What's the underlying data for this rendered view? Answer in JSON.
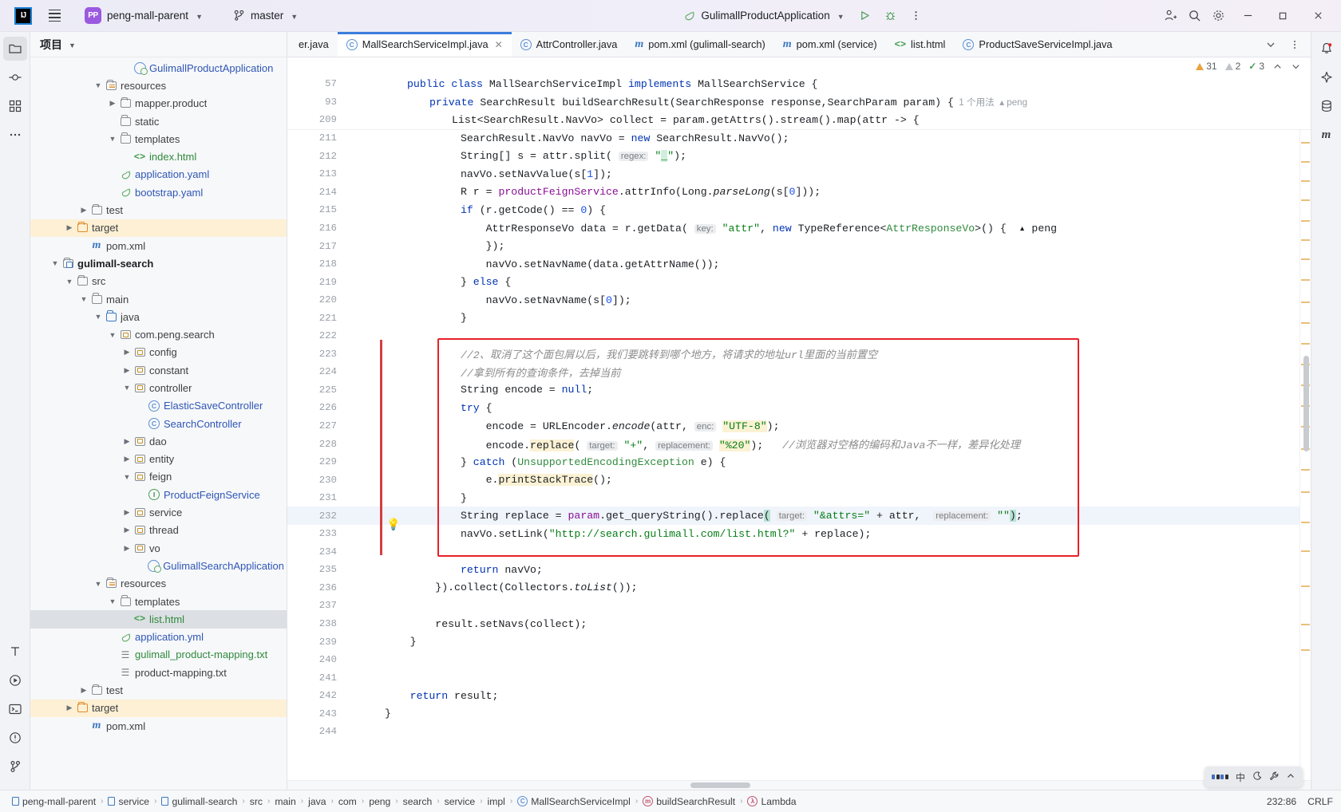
{
  "titlebar": {
    "logo": "IJ",
    "menu_icon": "hamburger-icon",
    "project_badge": "PP",
    "project_name": "peng-mall-parent",
    "branch_icon": "git-branch-icon",
    "branch_name": "master",
    "run_config_icon": "spring-boot-icon",
    "run_config": "GulimallProductApplication",
    "run_icon": "run-icon",
    "debug_icon": "debug-icon",
    "more_icon": "more-vertical-icon",
    "account_icon": "add-user-icon",
    "search_icon": "search-icon",
    "settings_icon": "gear-icon",
    "minimize": "–",
    "maximize": "❐",
    "close": "✕"
  },
  "left_rail": [
    {
      "name": "project-tool-icon",
      "glyph": "folder"
    },
    {
      "name": "commit-tool-icon",
      "glyph": "commit"
    },
    {
      "name": "structure-tool-icon",
      "glyph": "structure"
    },
    {
      "name": "more-tool-icon",
      "glyph": "dots"
    }
  ],
  "left_rail_bottom": [
    {
      "name": "todo-tool-icon",
      "glyph": "T"
    },
    {
      "name": "services-tool-icon",
      "glyph": "play"
    },
    {
      "name": "terminal-tool-icon",
      "glyph": "terminal"
    },
    {
      "name": "problems-tool-icon",
      "glyph": "warning"
    },
    {
      "name": "git-tool-icon",
      "glyph": "git"
    }
  ],
  "right_rail": [
    {
      "name": "notifications-icon",
      "glyph": "bell"
    },
    {
      "name": "ai-assistant-icon",
      "glyph": "ai"
    },
    {
      "name": "database-icon",
      "glyph": "db"
    },
    {
      "name": "maven-icon",
      "glyph": "m"
    }
  ],
  "project_panel": {
    "title": "项目",
    "title_chevron": "chevron-down-icon",
    "tree": [
      {
        "depth": 6,
        "arrow": "none",
        "icon": "spring-app",
        "label": "GulimallProductApplication",
        "color": "blue"
      },
      {
        "depth": 4,
        "arrow": "down",
        "icon": "resources",
        "label": "resources",
        "color": "grey"
      },
      {
        "depth": 5,
        "arrow": "right",
        "icon": "folder",
        "label": "mapper.product",
        "color": "grey"
      },
      {
        "depth": 5,
        "arrow": "none",
        "icon": "folder",
        "label": "static",
        "color": "grey"
      },
      {
        "depth": 5,
        "arrow": "down",
        "icon": "folder",
        "label": "templates",
        "color": "grey"
      },
      {
        "depth": 6,
        "arrow": "none",
        "icon": "html",
        "label": "index.html",
        "color": "green"
      },
      {
        "depth": 5,
        "arrow": "none",
        "icon": "spring",
        "label": "application.yaml",
        "color": "blue"
      },
      {
        "depth": 5,
        "arrow": "none",
        "icon": "spring",
        "label": "bootstrap.yaml",
        "color": "blue"
      },
      {
        "depth": 3,
        "arrow": "right",
        "icon": "folder",
        "label": "test",
        "color": "grey"
      },
      {
        "depth": 2,
        "arrow": "right",
        "icon": "folder-orange",
        "label": "target",
        "color": "grey",
        "highlight": "target"
      },
      {
        "depth": 3,
        "arrow": "none",
        "icon": "maven",
        "label": "pom.xml",
        "color": "grey"
      },
      {
        "depth": 1,
        "arrow": "down",
        "icon": "module",
        "label": "gulimall-search",
        "color": "bold"
      },
      {
        "depth": 2,
        "arrow": "down",
        "icon": "folder",
        "label": "src",
        "color": "grey"
      },
      {
        "depth": 3,
        "arrow": "down",
        "icon": "folder",
        "label": "main",
        "color": "grey"
      },
      {
        "depth": 4,
        "arrow": "down",
        "icon": "folder-blue",
        "label": "java",
        "color": "grey"
      },
      {
        "depth": 5,
        "arrow": "down",
        "icon": "package",
        "label": "com.peng.search",
        "color": "grey"
      },
      {
        "depth": 6,
        "arrow": "right",
        "icon": "package",
        "label": "config",
        "color": "grey"
      },
      {
        "depth": 6,
        "arrow": "right",
        "icon": "package",
        "label": "constant",
        "color": "grey"
      },
      {
        "depth": 6,
        "arrow": "down",
        "icon": "package",
        "label": "controller",
        "color": "grey"
      },
      {
        "depth": 7,
        "arrow": "none",
        "icon": "class",
        "label": "ElasticSaveController",
        "color": "blue"
      },
      {
        "depth": 7,
        "arrow": "none",
        "icon": "class",
        "label": "SearchController",
        "color": "blue"
      },
      {
        "depth": 6,
        "arrow": "right",
        "icon": "package",
        "label": "dao",
        "color": "grey"
      },
      {
        "depth": 6,
        "arrow": "right",
        "icon": "package",
        "label": "entity",
        "color": "grey"
      },
      {
        "depth": 6,
        "arrow": "down",
        "icon": "package",
        "label": "feign",
        "color": "grey"
      },
      {
        "depth": 7,
        "arrow": "none",
        "icon": "interface",
        "label": "ProductFeignService",
        "color": "blue"
      },
      {
        "depth": 6,
        "arrow": "right",
        "icon": "package",
        "label": "service",
        "color": "grey"
      },
      {
        "depth": 6,
        "arrow": "right",
        "icon": "package",
        "label": "thread",
        "color": "grey"
      },
      {
        "depth": 6,
        "arrow": "right",
        "icon": "package",
        "label": "vo",
        "color": "grey"
      },
      {
        "depth": 7,
        "arrow": "none",
        "icon": "spring-app",
        "label": "GulimallSearchApplication",
        "color": "blue"
      },
      {
        "depth": 4,
        "arrow": "down",
        "icon": "resources",
        "label": "resources",
        "color": "grey"
      },
      {
        "depth": 5,
        "arrow": "down",
        "icon": "folder",
        "label": "templates",
        "color": "grey"
      },
      {
        "depth": 6,
        "arrow": "none",
        "icon": "html",
        "label": "list.html",
        "color": "green",
        "selected": true
      },
      {
        "depth": 5,
        "arrow": "none",
        "icon": "spring",
        "label": "application.yml",
        "color": "blue"
      },
      {
        "depth": 5,
        "arrow": "none",
        "icon": "txt",
        "label": "gulimall_product-mapping.txt",
        "color": "green"
      },
      {
        "depth": 5,
        "arrow": "none",
        "icon": "txt",
        "label": "product-mapping.txt",
        "color": "grey"
      },
      {
        "depth": 3,
        "arrow": "right",
        "icon": "folder",
        "label": "test",
        "color": "grey"
      },
      {
        "depth": 2,
        "arrow": "right",
        "icon": "folder-orange",
        "label": "target",
        "color": "grey",
        "highlight": "target"
      },
      {
        "depth": 3,
        "arrow": "none",
        "icon": "maven",
        "label": "pom.xml",
        "color": "grey"
      }
    ]
  },
  "editor_tabs": {
    "cut_left_label": "er.java",
    "tabs": [
      {
        "label": "MallSearchServiceImpl.java",
        "icon": "class-icon",
        "active": true,
        "close": "✕"
      },
      {
        "label": "AttrController.java",
        "icon": "class-icon",
        "active": false
      },
      {
        "label": "pom.xml (gulimall-search)",
        "icon": "maven-icon",
        "active": false
      },
      {
        "label": "pom.xml (service)",
        "icon": "maven-icon",
        "active": false
      },
      {
        "label": "list.html",
        "icon": "html-icon",
        "active": false
      },
      {
        "label": "ProductSaveServiceImpl.java",
        "icon": "class-icon",
        "active": false
      }
    ],
    "overflow_icon": "chevron-down-icon",
    "tab_options_icon": "more-vertical-icon"
  },
  "inspections": {
    "warning_count": "31",
    "grey_count": "2",
    "ok_count": "3",
    "up_icon": "chevron-up-icon",
    "down_icon": "chevron-down-icon"
  },
  "sticky_lines": [
    {
      "num": "57",
      "indent": 1,
      "html": "<span class=\"kw\">public</span> <span class=\"kw\">class</span> MallSearchServiceImpl <span class=\"kw\">implements</span> MallSearchService {"
    },
    {
      "num": "93",
      "indent": 2,
      "html": "<span class=\"kw\">private</span> SearchResult buildSearchResult(SearchResponse response,SearchParam param) {<span class=\"hint-usages\">  1 个用法</span><span class=\"hint-author\">  ▴ peng</span>"
    },
    {
      "num": "209",
      "indent": 3,
      "html": "List&lt;SearchResult.NavVo&gt; collect = param.getAttrs().stream().map(attr -&gt; {"
    }
  ],
  "code_lines": [
    {
      "num": "211",
      "html": "            SearchResult.NavVo navVo = <span class=\"kw\">new</span> SearchResult.NavVo();"
    },
    {
      "num": "212",
      "html": "            String[] s = attr.split( <span class=\"hint\">regex:</span> <span class=\"str\">\"<span class=\"hl-green\">_</span>\"</span>);"
    },
    {
      "num": "213",
      "html": "            navVo.setNavValue(s[<span class=\"num\">1</span>]);"
    },
    {
      "num": "214",
      "html": "            R r = <span class=\"fld\">productFeignService</span>.attrInfo(Long.<span class=\"static-it\">parseLong</span>(s[<span class=\"num\">0</span>]));"
    },
    {
      "num": "215",
      "html": "            <span class=\"kw\">if</span> (r.getCode() == <span class=\"num\">0</span>) {"
    },
    {
      "num": "216",
      "html": "                AttrResponseVo data = r.getData( <span class=\"hint\">key:</span> <span class=\"str\">\"attr\"</span>, <span class=\"kw\">new</span> TypeReference&lt;<span class=\"type-green\">AttrResponseVo</span>&gt;() {<span class=\"hint-author\">  ▴ peng</span>"
    },
    {
      "num": "217",
      "html": "                });"
    },
    {
      "num": "218",
      "html": "                navVo.setNavName(data.getAttrName());"
    },
    {
      "num": "219",
      "html": "            } <span class=\"kw\">else</span> {"
    },
    {
      "num": "220",
      "html": "                navVo.setNavName(s[<span class=\"num\">0</span>]);"
    },
    {
      "num": "221",
      "html": "            }"
    },
    {
      "num": "222",
      "html": ""
    },
    {
      "num": "223",
      "html": "            <span class=\"cmt\">//2、取消了这个面包屑以后，我们要跳转到哪个地方，将请求的地址url里面的当前置空</span>"
    },
    {
      "num": "224",
      "html": "            <span class=\"cmt\">//拿到所有的查询条件，去掉当前</span>"
    },
    {
      "num": "225",
      "html": "            String <span class=\"underl\">encode</span> = <span class=\"kw\">null</span>;"
    },
    {
      "num": "226",
      "html": "            <span class=\"kw\">try</span> {"
    },
    {
      "num": "227",
      "html": "                <span class=\"underl\">encode</span> = URLEncoder.<span class=\"static-it\">encode</span>(attr, <span class=\"hint\">enc:</span> <span class=\"str hl-yellow\">\"UTF-8\"</span>);"
    },
    {
      "num": "228",
      "html": "                <span class=\"underl\">encode</span>.<span class=\"hl-yellow\">replace</span>( <span class=\"hint\">target:</span> <span class=\"str\">\"+\"</span>, <span class=\"hint\">replacement:</span> <span class=\"str hl-yellow\">\"%20\"</span>);   <span class=\"cmt\">//浏览器对空格的编码和Java不一样，差异化处理</span>"
    },
    {
      "num": "229",
      "html": "            } <span class=\"kw\">catch</span> (<span class=\"type-green\">UnsupportedEncodingException</span> e) {"
    },
    {
      "num": "230",
      "html": "                e.<span class=\"hl-yellow\">printStackTrace</span>();"
    },
    {
      "num": "231",
      "html": "            }"
    },
    {
      "num": "232",
      "html": "            String replace = <span class=\"fld\">param</span>.get_queryString().replace<span class=\"hl-cursor\">(</span> <span class=\"hint\">target:</span> <span class=\"str\">\"&amp;attrs=\"</span> + attr,  <span class=\"hint\">replacement:</span> <span class=\"str\">\"\"</span><span class=\"hl-cursor\">)</span>;",
      "current": true,
      "bulb": true
    },
    {
      "num": "233",
      "html": "            navVo.setLink(<span class=\"str\">\"http://search.gulimall.com/list.html?\"</span> + replace);"
    },
    {
      "num": "234",
      "html": ""
    },
    {
      "num": "235",
      "html": "            <span class=\"kw\">return</span> navVo;"
    },
    {
      "num": "236",
      "html": "        }).collect(Collectors.<span class=\"static-it\">toList</span>());"
    },
    {
      "num": "237",
      "html": ""
    },
    {
      "num": "238",
      "html": "        result.setNavs(collect);"
    },
    {
      "num": "239",
      "html": "    }"
    },
    {
      "num": "240",
      "html": ""
    },
    {
      "num": "241",
      "html": ""
    },
    {
      "num": "242",
      "html": "    <span class=\"kw\">return</span> result;"
    },
    {
      "num": "243",
      "html": "}"
    },
    {
      "num": "244",
      "html": ""
    }
  ],
  "breadcrumb": {
    "items": [
      {
        "label": "peng-mall-parent",
        "icon": "module-icon"
      },
      {
        "label": "service",
        "icon": "module-icon"
      },
      {
        "label": "gulimall-search",
        "icon": "module-icon"
      },
      {
        "label": "src",
        "icon": "none"
      },
      {
        "label": "main",
        "icon": "none"
      },
      {
        "label": "java",
        "icon": "none"
      },
      {
        "label": "com",
        "icon": "none"
      },
      {
        "label": "peng",
        "icon": "none"
      },
      {
        "label": "search",
        "icon": "none"
      },
      {
        "label": "service",
        "icon": "none"
      },
      {
        "label": "impl",
        "icon": "none"
      },
      {
        "label": "MallSearchServiceImpl",
        "icon": "class-icon"
      },
      {
        "label": "buildSearchResult",
        "icon": "method-icon"
      },
      {
        "label": "Lambda",
        "icon": "lambda-icon"
      }
    ],
    "separator": "›",
    "caret_position": "232:86",
    "line_separator": "CRLF"
  },
  "ime": {
    "keyboard_icon": "keyboard-icon",
    "lang": "中",
    "moon_icon": "moon-icon",
    "tool_icon": "wrench-icon",
    "chevron_icon": "chevron-up-icon"
  }
}
